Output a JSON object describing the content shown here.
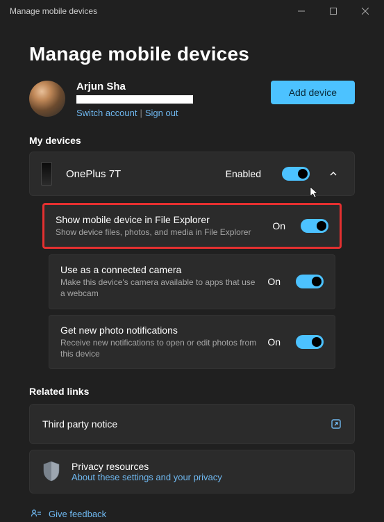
{
  "window": {
    "title": "Manage mobile devices"
  },
  "page": {
    "title": "Manage mobile devices"
  },
  "user": {
    "name": "Arjun Sha",
    "switch_account": "Switch account",
    "sign_out": "Sign out"
  },
  "buttons": {
    "add_device": "Add device"
  },
  "sections": {
    "my_devices": "My devices",
    "related_links": "Related links"
  },
  "device": {
    "name": "OnePlus 7T",
    "status_label": "Enabled",
    "options": [
      {
        "title": "Show mobile device in File Explorer",
        "desc": "Show device files, photos, and media in File Explorer",
        "state": "On"
      },
      {
        "title": "Use as a connected camera",
        "desc": "Make this device's camera available to apps that use a webcam",
        "state": "On"
      },
      {
        "title": "Get new photo notifications",
        "desc": "Receive new notifications to open or edit photos from this device",
        "state": "On"
      }
    ]
  },
  "related": {
    "third_party": "Third party notice"
  },
  "privacy": {
    "title": "Privacy resources",
    "link": "About these settings and your privacy"
  },
  "feedback": {
    "label": "Give feedback"
  }
}
